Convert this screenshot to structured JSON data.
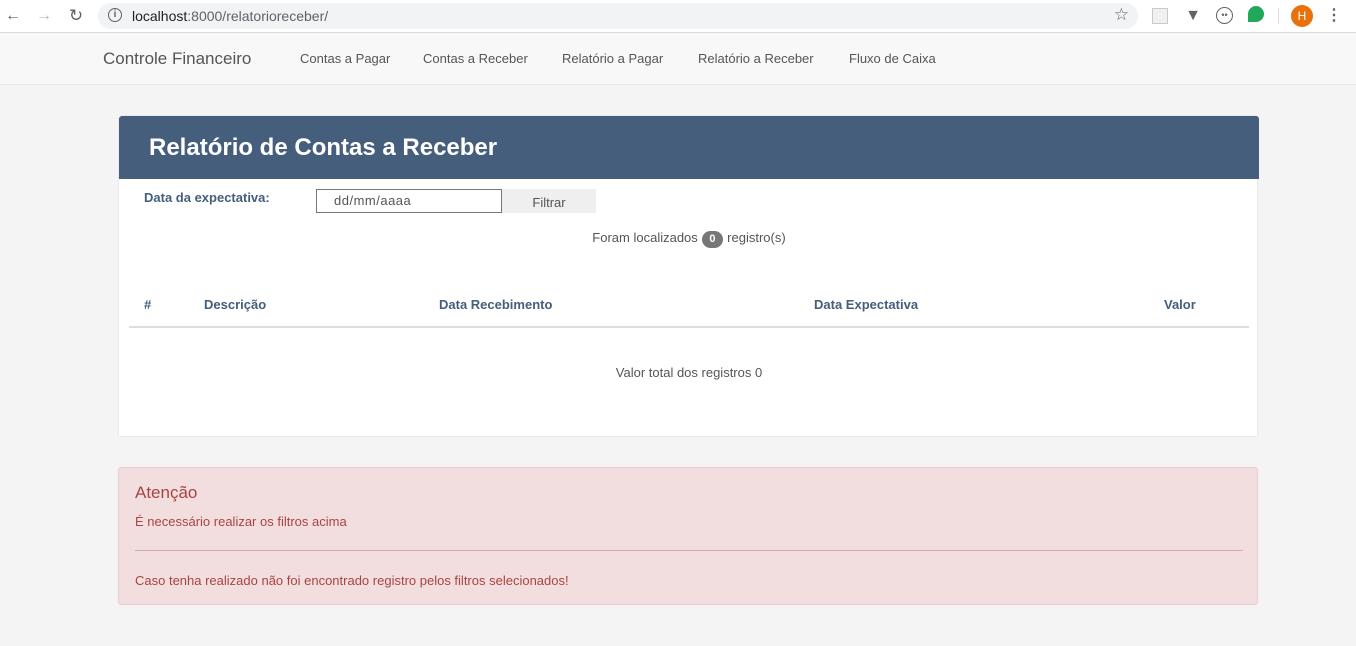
{
  "browser": {
    "url_host": "localhost",
    "url_path": ":8000/relatorioreceber/",
    "avatar_letter": "H"
  },
  "navbar": {
    "brand": "Controle Financeiro",
    "links": [
      "Contas a Pagar",
      "Contas a Receber",
      "Relatório a Pagar",
      "Relatório a Receber",
      "Fluxo de Caixa"
    ]
  },
  "report": {
    "title": "Relatório de Contas a Receber",
    "filter_label": "Data da expectativa:",
    "date_placeholder": "dd/mm/aaaa",
    "filter_button": "Filtrar",
    "found_prefix": "Foram localizados",
    "found_count": "0",
    "found_suffix": "registro(s)",
    "columns": [
      "#",
      "Descrição",
      "Data Recebimento",
      "Data Expectativa",
      "Valor"
    ],
    "rows": [],
    "total_label": "Valor total dos registros 0"
  },
  "alert": {
    "title": "Atenção",
    "message1": "É necessário realizar os filtros acima",
    "message2": "Caso tenha realizado não foi encontrado registro pelos filtros selecionados!"
  },
  "colors": {
    "panel_header": "#445e7c",
    "alert_bg": "#f2dede",
    "alert_text": "#a94442",
    "avatar": "#e8710a"
  }
}
